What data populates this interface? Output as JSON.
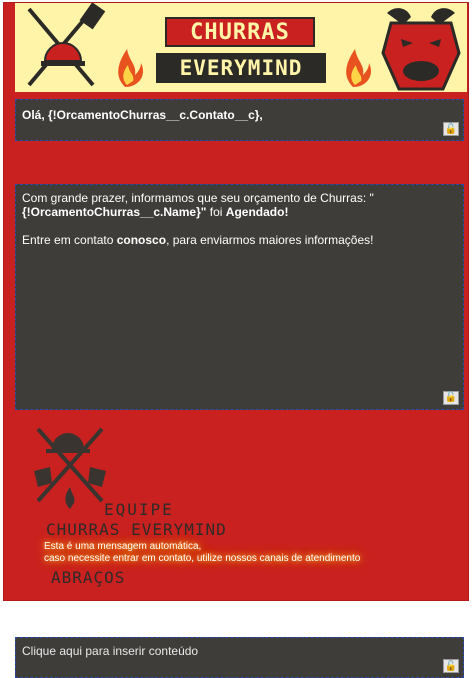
{
  "banner": {
    "title": "CHURRAS",
    "subtitle": "EVERYMIND"
  },
  "editor": {
    "greeting": "Olá, {!OrcamentoChurras__c.Contato__c},",
    "message_intro": "Com grande prazer, informamos que seu orçamento de Churras: \"",
    "message_merge": "{!OrcamentoChurras__c.Name}\"",
    "message_foi": " foi ",
    "message_status": "Agendado!",
    "contact_pre": "Entre em contato ",
    "contact_bold": "conosco",
    "contact_post": ", para enviarmos maiores informações!",
    "placeholder": "Clique aqui para inserir conteúdo",
    "lock_icon": "lock-icon"
  },
  "footer": {
    "team_line1": "EQUIPE",
    "team_line2": "CHURRAS EVERYMIND",
    "auto_msg1": "Esta é uma mensagem automática,",
    "auto_msg2": "caso necessite entrar em contato, utilize nossos canais de atendimento",
    "regards": "ABRAÇOS"
  },
  "colors": {
    "brand_red": "#c9211f",
    "cream": "#fff4a8",
    "dark": "#3f3d39"
  }
}
